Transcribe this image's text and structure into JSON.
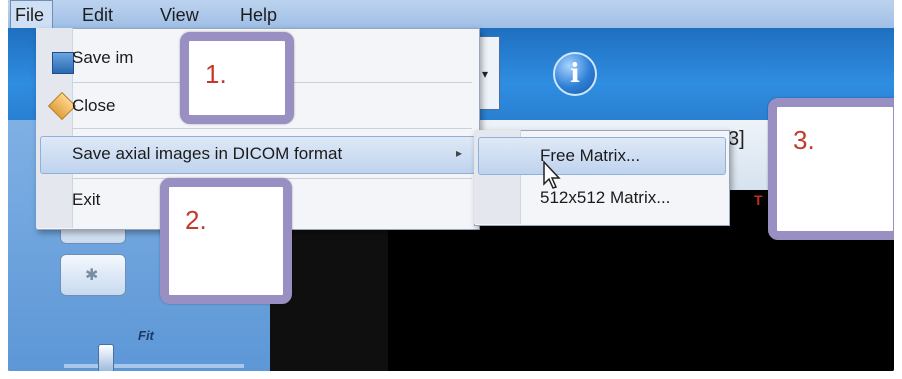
{
  "menubar": {
    "items": [
      "File",
      "Edit",
      "View",
      "Help"
    ]
  },
  "file_menu": {
    "items": [
      {
        "label": "Save im",
        "icon": "save-icon"
      },
      {
        "label": "Close",
        "icon": "close-icon"
      },
      {
        "label": "Save axial images in DICOM format",
        "has_submenu": true
      },
      {
        "label": "Exit"
      }
    ]
  },
  "submenu": {
    "items": [
      {
        "label": "Free Matrix..."
      },
      {
        "label": "512x512 Matrix..."
      }
    ]
  },
  "toolbar": {
    "dropdown_arrow": "▾",
    "info_glyph": "i"
  },
  "panel": {
    "strip_text": "3]",
    "red_mark": "T",
    "fit_label": "Fit"
  },
  "callouts": [
    "1.",
    "2.",
    "3."
  ],
  "colors": {
    "toolbar_blue": "#2f8de0",
    "callout_border": "#9a8fc2",
    "callout_text": "#c33a2c",
    "highlight": "#bfd3ee"
  }
}
